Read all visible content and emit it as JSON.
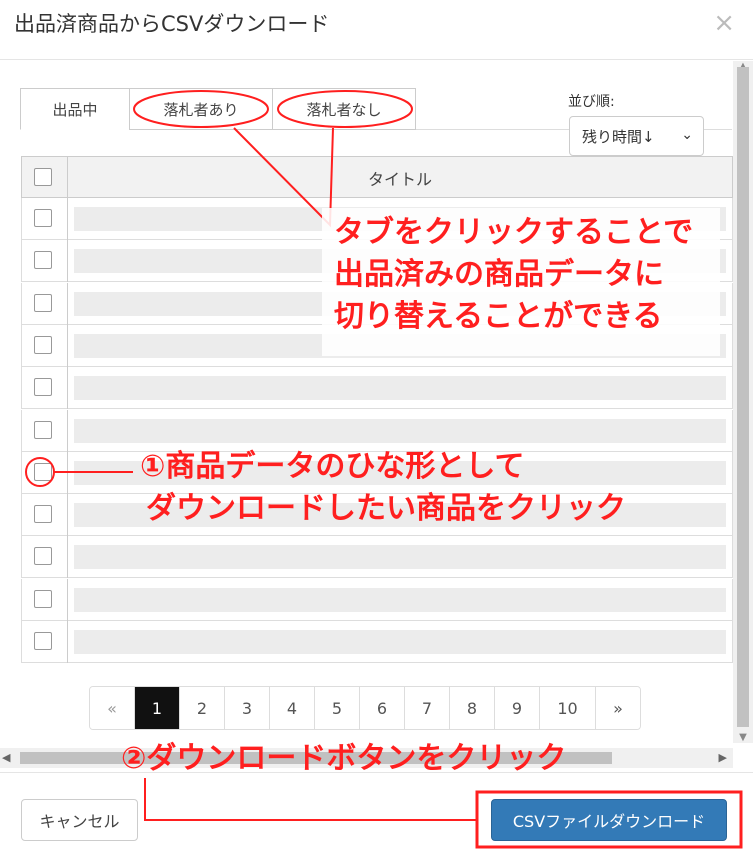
{
  "dialog": {
    "title": "出品済商品からCSVダウンロード",
    "close": "×"
  },
  "tabs": [
    {
      "label": "出品中"
    },
    {
      "label": "落札者あり"
    },
    {
      "label": "落札者なし"
    }
  ],
  "sort": {
    "label": "並び順:",
    "value": "残り時間↓",
    "chevron": "⌄"
  },
  "table": {
    "header_title": "タイトル",
    "row_count": 11
  },
  "pagination": {
    "prev": "«",
    "pages": [
      "1",
      "2",
      "3",
      "4",
      "5",
      "6",
      "7",
      "8",
      "9",
      "10"
    ],
    "next": "»",
    "current": "1"
  },
  "footer": {
    "cancel": "キャンセル",
    "download": "CSVファイルダウンロード"
  },
  "annotations": {
    "tabs_note": [
      "タブをクリックすることで",
      "出品済みの商品データに",
      "切り替えることができる"
    ],
    "step1": [
      "①商品データのひな形として",
      "ダウンロードしたい商品をクリック"
    ],
    "step2": "②ダウンロードボタンをクリック"
  },
  "colors": {
    "annotation": "#ff1f1f",
    "primary_button": "#337ab7",
    "active_page": "#111111"
  },
  "scroll": {
    "h_left": "◀",
    "h_right": "▶",
    "v_up": "▲",
    "v_down": "▼"
  }
}
